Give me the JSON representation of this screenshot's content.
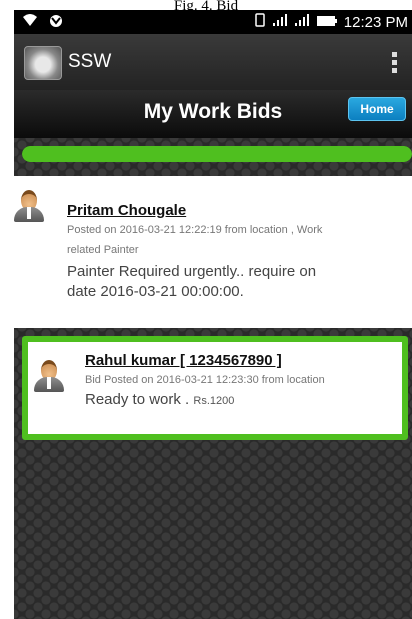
{
  "caption": "Fig. 4. Bid",
  "status_bar": {
    "time": "12:23 PM",
    "icons": [
      "wifi-icon",
      "notification-icon",
      "vibrate-icon",
      "signal-icon",
      "signal-icon",
      "battery-icon"
    ]
  },
  "action_bar": {
    "app_name": "SSW",
    "icons": [
      "app-logo-icon",
      "overflow-menu-icon"
    ]
  },
  "header": {
    "title": "My Work Bids",
    "home_label": "Home"
  },
  "progress": {
    "fraction": 1.0,
    "color": "#4fbf1f"
  },
  "posts": [
    {
      "name": "Pritam Chougale",
      "meta_line1": "Posted on 2016-03-21 12:22:19 from location , Work",
      "meta_line2": "related Painter",
      "desc_line1": "Painter Required urgently.. require on",
      "desc_line2": "date 2016-03-21 00:00:00."
    }
  ],
  "bids": [
    {
      "name": "Rahul kumar [ 1234567890 ]",
      "meta": "Bid Posted on 2016-03-21 12:23:30 from location",
      "desc": "Ready to work .",
      "amount": "Rs.1200",
      "highlight_color": "#4fbf1f"
    }
  ]
}
